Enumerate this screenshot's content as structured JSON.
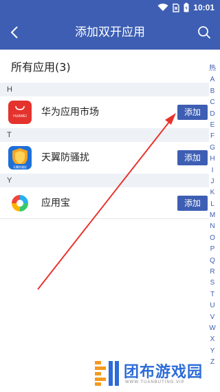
{
  "status_bar": {
    "time": "10:01"
  },
  "app_bar": {
    "title": "添加双开应用"
  },
  "section": {
    "heading": "所有应用(3)"
  },
  "groups": [
    {
      "letter": "H",
      "app": {
        "name": "华为应用市场",
        "icon": "huawei-appgallery-icon",
        "icon_text": "HUAWEI",
        "add_label": "添加"
      }
    },
    {
      "letter": "T",
      "app": {
        "name": "天翼防骚扰",
        "icon": "tianyi-anti-harassment-icon",
        "icon_text": "天翼防骚扰",
        "add_label": "添加"
      }
    },
    {
      "letter": "Y",
      "app": {
        "name": "应用宝",
        "icon": "yingyongbao-icon",
        "add_label": "添加"
      }
    }
  ],
  "index_bar": [
    "热",
    "A",
    "B",
    "C",
    "D",
    "E",
    "F",
    "G",
    "H",
    "I",
    "J",
    "K",
    "L",
    "M",
    "N",
    "O",
    "P",
    "Q",
    "R",
    "S",
    "T",
    "U",
    "V",
    "W",
    "X",
    "Y",
    "Z"
  ],
  "watermark": {
    "title": "团布游戏园",
    "url": "WWW.TUANBUTING.VIP"
  },
  "colors": {
    "primary": "#3d5eb3",
    "group_header_bg": "#eef1f6",
    "annotation_arrow": "#e8342b",
    "huawei_red": "#e4322d",
    "watermark_blue": "#2c6bd8",
    "watermark_orange": "#f39a1e"
  }
}
